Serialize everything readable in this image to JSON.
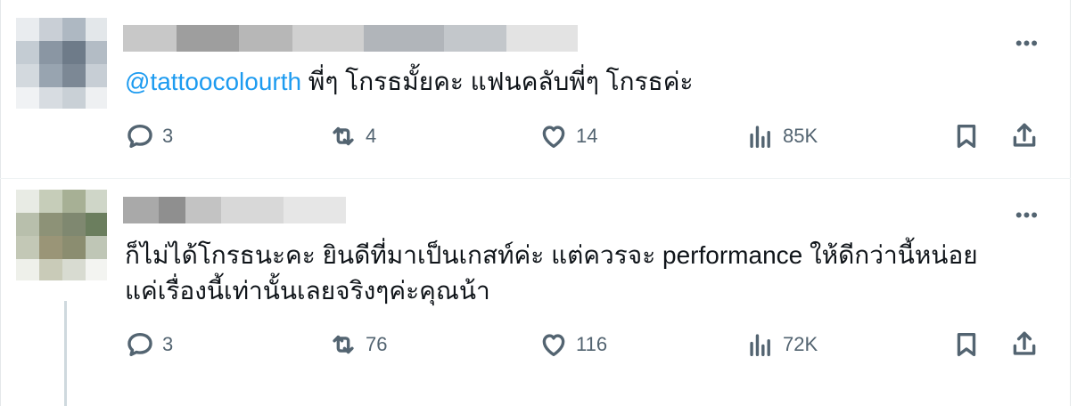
{
  "tweets": [
    {
      "mention": "@tattoocolourth",
      "text": " พี่ๆ โกรธมั้ยคะ แฟนคลับพี่ๆ โกรธค่ะ",
      "more_icon": "more-icon",
      "actions": {
        "replies": "3",
        "retweets": "4",
        "likes": "14",
        "views": "85K"
      }
    },
    {
      "text_line1": "ก็ไม่ได้โกรธนะคะ ยินดีที่มาเป็นเกสท์ค่ะ แต่ควรจะ performance ให้ดีกว่านี้หน่อย",
      "text_line2": "แค่เรื่องนี้เท่านั้นเลยจริงๆค่ะคุณน้า",
      "more_icon": "more-icon",
      "actions": {
        "replies": "3",
        "retweets": "76",
        "likes": "116",
        "views": "72K"
      }
    }
  ],
  "icons": {
    "reply": "reply-icon",
    "retweet": "retweet-icon",
    "like": "heart-icon",
    "views": "views-icon",
    "bookmark": "bookmark-icon",
    "share": "share-icon"
  },
  "colors": {
    "mention": "#1d9bf0",
    "muted": "#536471",
    "text": "#0f1419"
  }
}
